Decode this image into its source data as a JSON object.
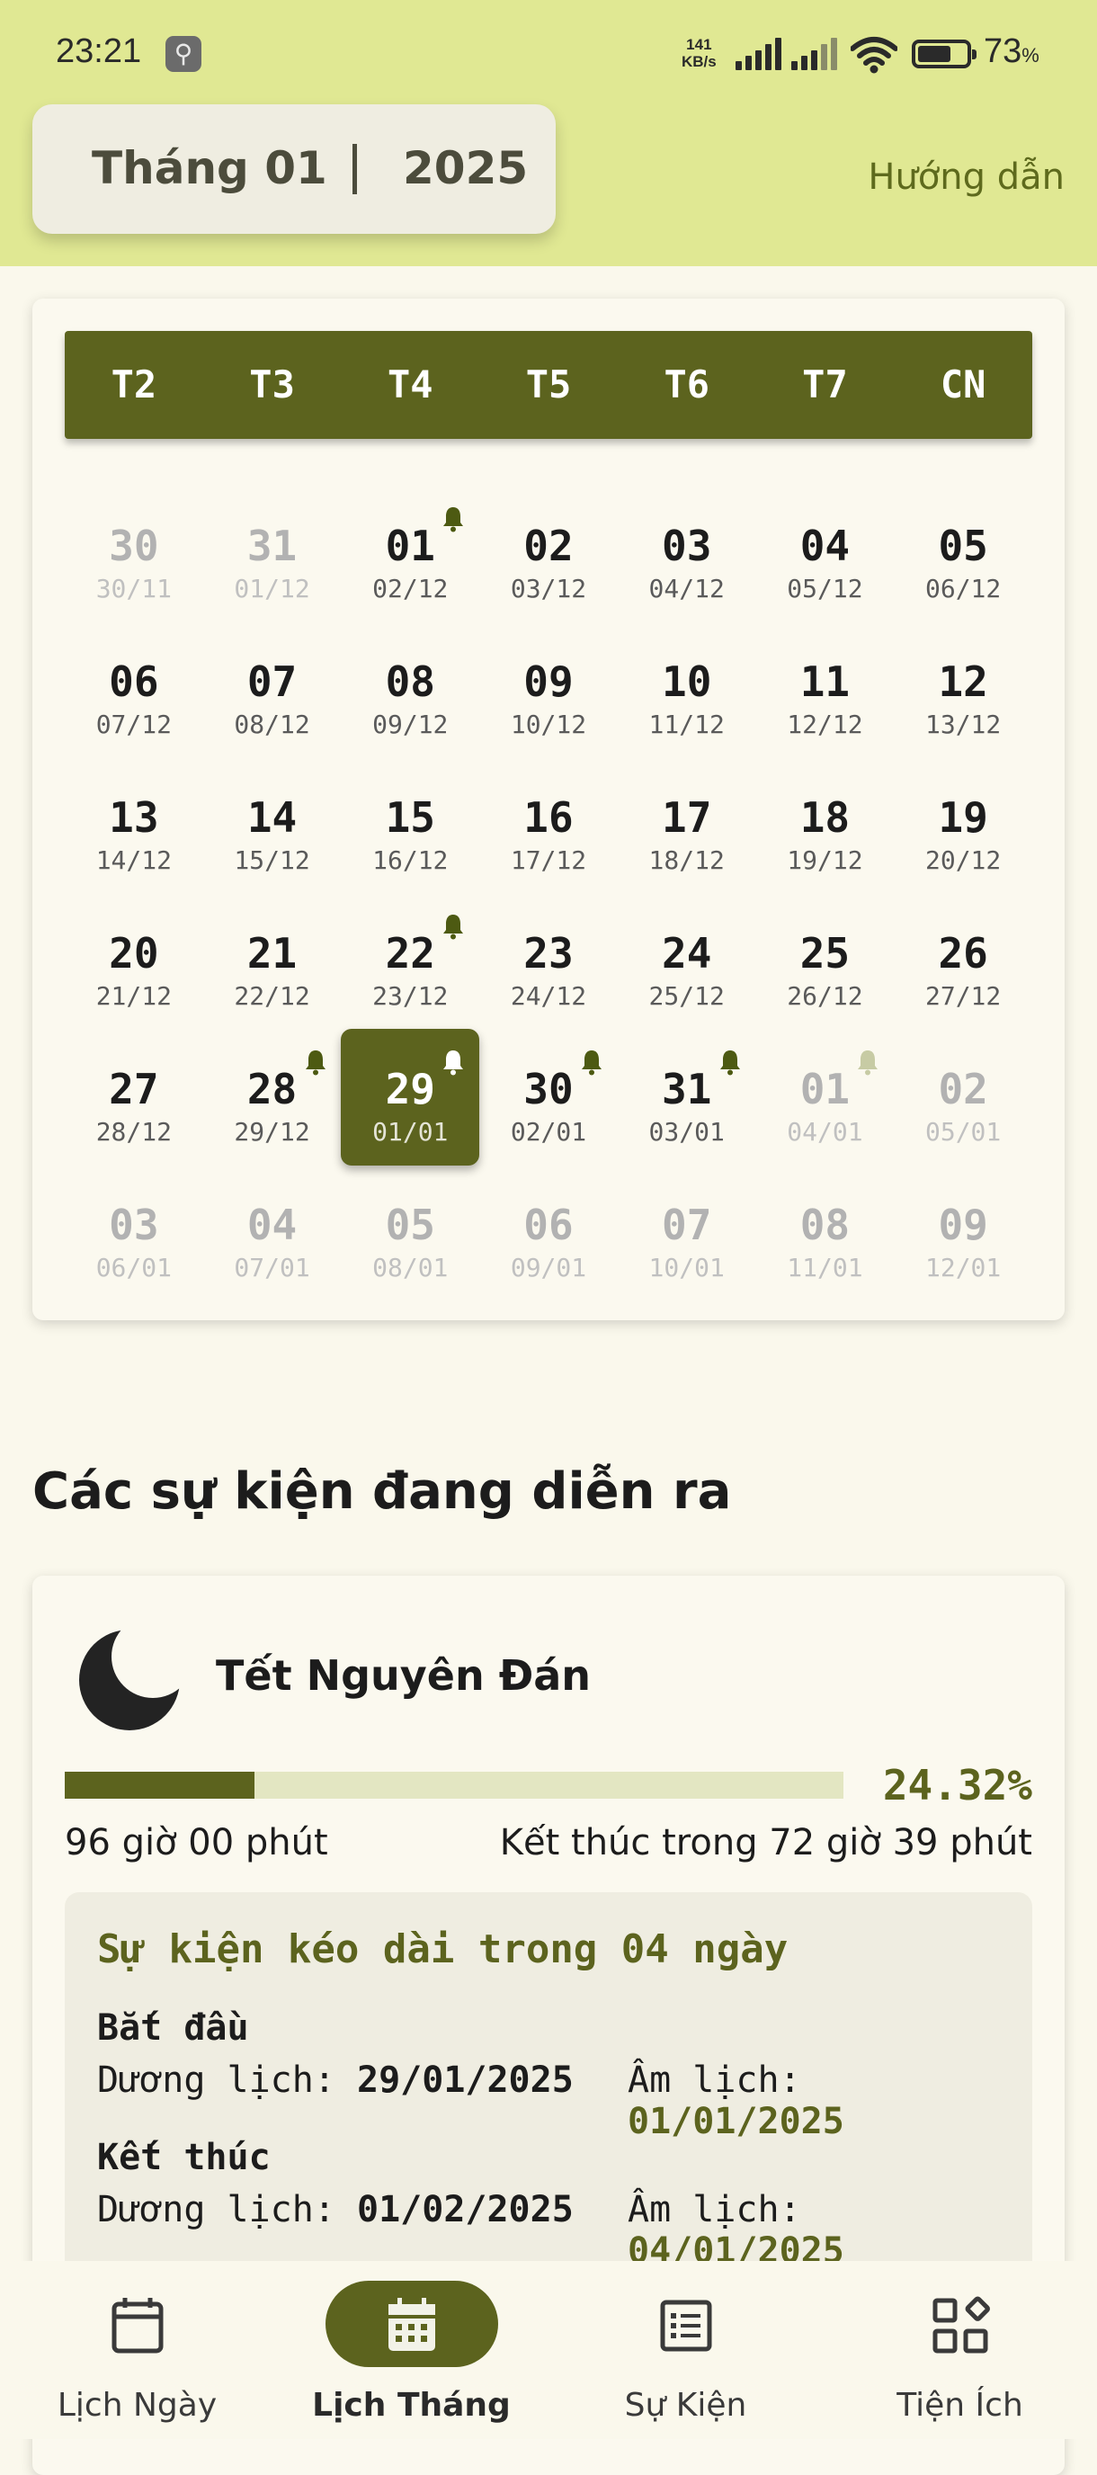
{
  "status_bar": {
    "time": "23:21",
    "net_speed_value": "141",
    "net_speed_unit": "KB/s",
    "battery": "73",
    "battery_unit": "%"
  },
  "header": {
    "month": "Tháng 01",
    "year": "2025",
    "guide": "Hướng dẫn"
  },
  "calendar": {
    "weekdays": [
      "T2",
      "T3",
      "T4",
      "T5",
      "T6",
      "T7",
      "CN"
    ],
    "weeks": [
      [
        {
          "d": "30",
          "l": "30/11",
          "dim": true
        },
        {
          "d": "31",
          "l": "01/12",
          "dim": true
        },
        {
          "d": "01",
          "l": "02/12",
          "bell": true
        },
        {
          "d": "02",
          "l": "03/12"
        },
        {
          "d": "03",
          "l": "04/12"
        },
        {
          "d": "04",
          "l": "05/12"
        },
        {
          "d": "05",
          "l": "06/12"
        }
      ],
      [
        {
          "d": "06",
          "l": "07/12"
        },
        {
          "d": "07",
          "l": "08/12"
        },
        {
          "d": "08",
          "l": "09/12"
        },
        {
          "d": "09",
          "l": "10/12"
        },
        {
          "d": "10",
          "l": "11/12"
        },
        {
          "d": "11",
          "l": "12/12"
        },
        {
          "d": "12",
          "l": "13/12"
        }
      ],
      [
        {
          "d": "13",
          "l": "14/12"
        },
        {
          "d": "14",
          "l": "15/12"
        },
        {
          "d": "15",
          "l": "16/12"
        },
        {
          "d": "16",
          "l": "17/12"
        },
        {
          "d": "17",
          "l": "18/12"
        },
        {
          "d": "18",
          "l": "19/12"
        },
        {
          "d": "19",
          "l": "20/12"
        }
      ],
      [
        {
          "d": "20",
          "l": "21/12"
        },
        {
          "d": "21",
          "l": "22/12"
        },
        {
          "d": "22",
          "l": "23/12",
          "bell": true
        },
        {
          "d": "23",
          "l": "24/12"
        },
        {
          "d": "24",
          "l": "25/12"
        },
        {
          "d": "25",
          "l": "26/12"
        },
        {
          "d": "26",
          "l": "27/12"
        }
      ],
      [
        {
          "d": "27",
          "l": "28/12"
        },
        {
          "d": "28",
          "l": "29/12",
          "bell": true
        },
        {
          "d": "29",
          "l": "01/01",
          "bell": true,
          "selected": true
        },
        {
          "d": "30",
          "l": "02/01",
          "bell": true
        },
        {
          "d": "31",
          "l": "03/01",
          "bell": true
        },
        {
          "d": "01",
          "l": "04/01",
          "dim": true,
          "bell": true
        },
        {
          "d": "02",
          "l": "05/01",
          "dim": true
        }
      ],
      [
        {
          "d": "03",
          "l": "06/01",
          "dim": true
        },
        {
          "d": "04",
          "l": "07/01",
          "dim": true
        },
        {
          "d": "05",
          "l": "08/01",
          "dim": true
        },
        {
          "d": "06",
          "l": "09/01",
          "dim": true
        },
        {
          "d": "07",
          "l": "10/01",
          "dim": true
        },
        {
          "d": "08",
          "l": "11/01",
          "dim": true
        },
        {
          "d": "09",
          "l": "12/01",
          "dim": true
        }
      ]
    ]
  },
  "events": {
    "title": "Các sự kiện đang diễn ra",
    "event": {
      "name": "Tết Nguyên Đán",
      "progress_fraction": 0.2432,
      "percent": "24.32%",
      "duration": "96 giờ 00 phút",
      "remaining": "Kết thúc trong 72 giờ 39 phút",
      "detail_heading": "Sự kiện kéo dài trong 04 ngày",
      "start_label": "Bắt đầu",
      "end_label": "Kết thúc",
      "solar_label": "Dương lịch: ",
      "lunar_label": "Âm lịch: ",
      "start_solar": "29/01/2025",
      "start_lunar": "01/01/2025",
      "end_solar": "01/02/2025",
      "end_lunar": "04/01/2025"
    }
  },
  "bottom_nav": {
    "items": [
      {
        "label": "Lịch Ngày",
        "icon": "calendar-day-icon"
      },
      {
        "label": "Lịch Tháng",
        "icon": "calendar-month-icon",
        "active": true
      },
      {
        "label": "Sự Kiện",
        "icon": "event-list-icon"
      },
      {
        "label": "Tiện Ích",
        "icon": "widgets-icon"
      }
    ]
  },
  "colors": {
    "accent": "#5c631e",
    "header_bg": "#e0e893",
    "page_bg": "#faf8ec",
    "bell": "#4d5a12"
  }
}
